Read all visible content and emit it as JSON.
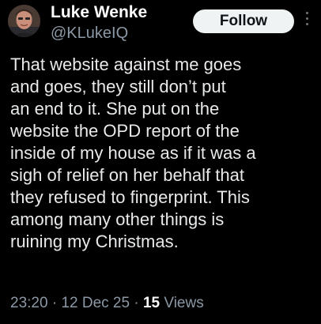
{
  "author": {
    "display_name": "Luke Wenke",
    "handle": "@KLukeIQ",
    "avatar_icon": "profile-photo"
  },
  "actions": {
    "follow_label": "Follow",
    "more_icon": "more-vertical-icon"
  },
  "tweet": {
    "lines": [
      "That website against me goes",
      "and goes, they still don’t put",
      "an end to it.  She put on the",
      "website the OPD report of the",
      "inside of my house as if it was a",
      "sigh of relief on her behalf that",
      "they refused to fingerprint.  This",
      "among many other things is",
      "ruining my Christmas."
    ]
  },
  "meta": {
    "time": "23:20",
    "separator": " · ",
    "date": "12 Dec 25",
    "views_count": "15",
    "views_label": " Views"
  },
  "colors": {
    "background": "#000000",
    "primary_text": "#e7e9ea",
    "secondary_text": "#8b98a5",
    "follow_button_bg": "#eff3f4"
  }
}
